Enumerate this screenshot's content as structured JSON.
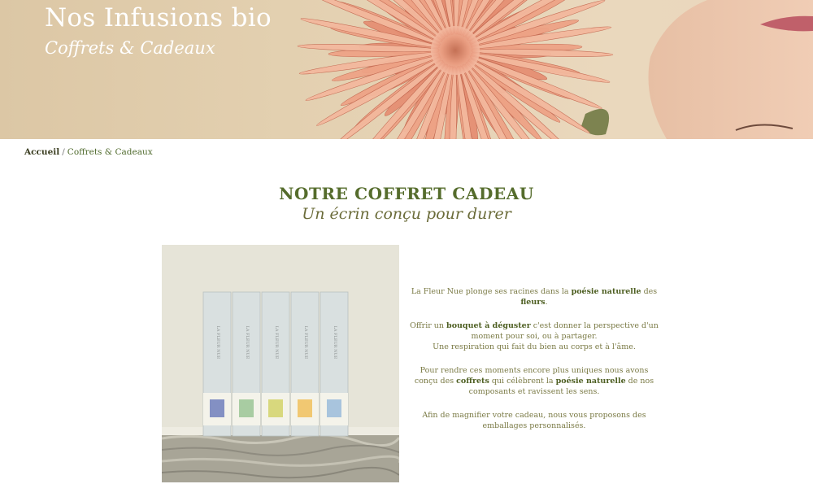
{
  "hero": {
    "title": "Nos Infusions bio",
    "subtitle": "Coffrets & Cadeaux"
  },
  "breadcrumb": {
    "home": "Accueil",
    "separator": "/",
    "current": "Coffrets & Cadeaux"
  },
  "section": {
    "heading": "NOTRE COFFRET CADEAU",
    "subheading": "Un écrin conçu pour durer"
  },
  "photo": {
    "box_label": "LA FLEUR NUE",
    "box_caption": "Infusion de fleurs bio"
  },
  "copy": {
    "p1": {
      "a": "La Fleur Nue plonge ses racines dans la ",
      "b1": "poésie naturelle",
      "c": " des ",
      "b2": "fleurs",
      "d": "."
    },
    "p2": {
      "a": "Offrir un ",
      "b1": "bouquet à déguster",
      "c": " c'est donner la perspective d'un moment pour soi, ou à partager.",
      "d": "Une respiration qui fait du bien au corps et à l'âme."
    },
    "p3": {
      "a": "Pour rendre ces moments encore plus uniques nous avons conçu des ",
      "b1": "coffrets",
      "c": " qui célèbrent la ",
      "b2": "poésie naturelle",
      "d": " de nos composants et ravissent les sens."
    },
    "p4": "Afin de magnifier votre cadeau, nous vous proposons des emballages personnalisés."
  },
  "colors": {
    "accent_green": "#556c2c",
    "text_olive": "#7a7a45",
    "hero_beige": "#e3d0b0",
    "flower_peach": "#e9967a"
  }
}
